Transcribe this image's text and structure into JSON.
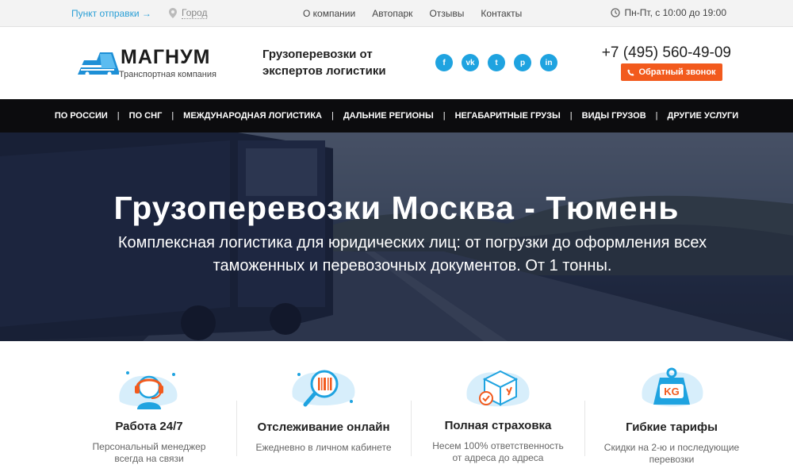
{
  "topbar": {
    "dispatch_label": "Пункт отправки →",
    "city_label": "Город",
    "nav": [
      "О компании",
      "Автопарк",
      "Отзывы",
      "Контакты"
    ],
    "hours": "Пн-Пт, с 10:00 до 19:00"
  },
  "header": {
    "logo_title": "МАГНУМ",
    "logo_subtitle": "Транспортная компания",
    "tagline": "Грузоперевозки от экспертов логистики",
    "socials": [
      {
        "icon": "facebook-icon",
        "glyph": "f"
      },
      {
        "icon": "vk-icon",
        "glyph": "vk"
      },
      {
        "icon": "twitter-icon",
        "glyph": "t"
      },
      {
        "icon": "pinterest-icon",
        "glyph": "p"
      },
      {
        "icon": "linkedin-icon",
        "glyph": "in"
      }
    ],
    "phone": "+7 (495) 560-49-09",
    "callback_label": "Обратный звонок"
  },
  "mainnav": {
    "items": [
      "По России",
      "По СНГ",
      "Международная логистика",
      "Дальние регионы",
      "Негабаритные грузы",
      "Виды грузов",
      "Другие услуги"
    ]
  },
  "hero": {
    "title": "Грузоперевозки Москва - Тюмень",
    "subtitle": "Комплексная логистика для юридических лиц: от погрузки до оформления всех таможенных и перевозочных документов. От 1 тонны."
  },
  "features": [
    {
      "icon": "headset-operator-icon",
      "title": "Работа 24/7",
      "desc": "Персональный менеджер всегда на связи"
    },
    {
      "icon": "barcode-magnifier-icon",
      "title": "Отслеживание онлайн",
      "desc": "Ежедневно в личном кабинете"
    },
    {
      "icon": "insured-box-icon",
      "title": "Полная страховка",
      "desc": "Несем 100% ответственность от адреса до адреса"
    },
    {
      "icon": "kg-weight-icon",
      "title": "Гибкие тарифы",
      "desc": "Скидки на 2-ю и последующие перевозки"
    }
  ],
  "colors": {
    "accent_blue": "#1fa3e0",
    "accent_orange": "#f25a1d",
    "nav_bg": "#0c0c0e"
  }
}
